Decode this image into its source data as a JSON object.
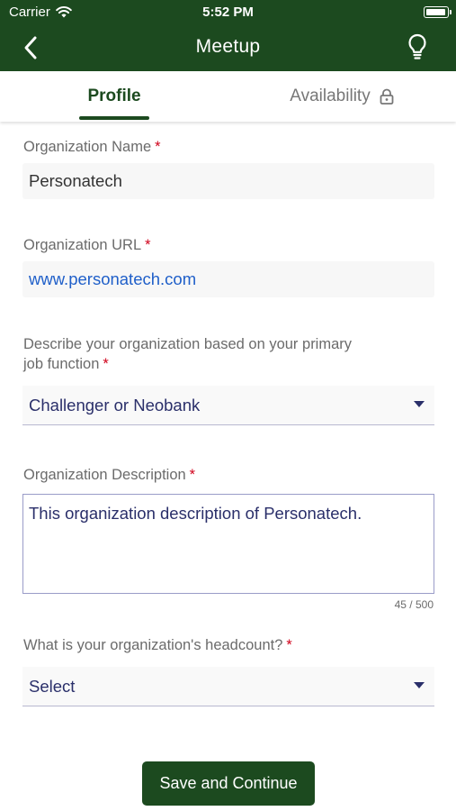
{
  "status_bar": {
    "carrier": "Carrier",
    "time": "5:52 PM",
    "icons": [
      "wifi-icon",
      "battery-icon"
    ]
  },
  "nav": {
    "title": "Meetup",
    "back_icon": "chevron-left-icon",
    "right_icon": "lightbulb-icon"
  },
  "tabs": [
    {
      "label": "Profile",
      "active": true
    },
    {
      "label": "Availability",
      "active": false,
      "icon": "lock-icon"
    }
  ],
  "form": {
    "org_name": {
      "label": "Organization Name",
      "required_mark": "*",
      "value": "Personatech"
    },
    "org_url": {
      "label": "Organization URL",
      "required_mark": "*",
      "value": "www.personatech.com"
    },
    "job_function": {
      "label_line1": "Describe your organization based on your primary",
      "label_line2": "job function",
      "required_mark": "*",
      "selected": "Challenger or Neobank"
    },
    "org_description": {
      "label": "Organization Description",
      "required_mark": "*",
      "value": "This organization description of Personatech.",
      "counter": "45 / 500"
    },
    "headcount": {
      "label": "What is your organization's headcount?",
      "required_mark": "*",
      "selected": "Select"
    }
  },
  "actions": {
    "save_label": "Save and Continue"
  },
  "colors": {
    "primary": "#1c4a1f",
    "required": "#d0021b",
    "link": "#1f5fc9",
    "input_text": "#2a2f6a"
  }
}
